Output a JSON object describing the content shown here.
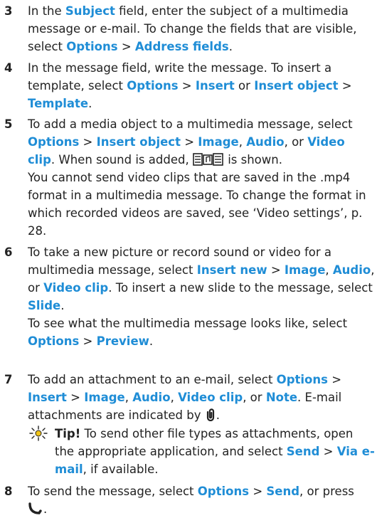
{
  "steps": [
    {
      "number": "3",
      "t1": "In the ",
      "b1": "Subject",
      "t2": " field, enter the subject of a multimedia message or e-mail. To change the fields that are visible, select ",
      "b2": "Options",
      "t3": " > ",
      "b3": "Address fields",
      "t4": "."
    },
    {
      "number": "4",
      "t1": "In the message field, write the message. To insert a template, select ",
      "b1": "Options",
      "t2": " > ",
      "b2": "Insert",
      "t3": " or ",
      "b3": "Insert object",
      "t4": " > ",
      "b4": "Template",
      "t5": "."
    },
    {
      "number": "5",
      "t1": "To add a media object to a multimedia message, select ",
      "b1": "Options",
      "t2": " > ",
      "b2": "Insert object",
      "t3": " > ",
      "b3": "Image",
      "t4": ", ",
      "b4": "Audio",
      "t5": ", or ",
      "b5": "Video clip",
      "t6": ". When sound is added, ",
      "icon1": "sound-added-icon",
      "t7": " is shown.",
      "p2": "You cannot send video clips that are saved in the .mp4 format in a multimedia message. To change the format in which recorded videos are saved, see ‘Video settings’, p. 28."
    },
    {
      "number": "6",
      "t1": "To take a new picture or record sound or video for a multimedia message, select ",
      "b1": "Insert new",
      "t2": " > ",
      "b2": "Image",
      "t3": ", ",
      "b3": "Audio",
      "t4": ", or ",
      "b4": "Video clip",
      "t5": ". To insert a new slide to the message, select ",
      "b5": "Slide",
      "t6": ".",
      "p2_t1": "To see what the multimedia message looks like, select ",
      "p2_b1": "Options",
      "p2_t2": " > ",
      "p2_b2": "Preview",
      "p2_t3": "."
    },
    {
      "number": "7",
      "t1": "To add an attachment to an e-mail, select ",
      "b1": "Options",
      "t2": " > ",
      "b2": "Insert",
      "t3": " > ",
      "b3": "Image",
      "t4": ", ",
      "b4": "Audio",
      "t5": ", ",
      "b5": "Video clip",
      "t6": ", or ",
      "b6": "Note",
      "t7": ". E-mail attachments are indicated by ",
      "icon1": "paperclip-icon",
      "t8": "."
    },
    {
      "number": "8",
      "t1": "To send the message, select ",
      "b1": "Options",
      "t2": " > ",
      "b2": "Send",
      "t3": ", or press ",
      "icon1": "call-key-icon",
      "t4": "."
    }
  ],
  "tip": {
    "icon": "lightbulb-tip-icon",
    "label": "Tip!",
    "t1": " To send other file types as attachments, open the appropriate application, and select ",
    "b1": "Send",
    "t2": " > ",
    "b2": "Via e-mail",
    "t3": ", if available."
  },
  "colors": {
    "highlight": "#1f8dd6",
    "text": "#222222"
  }
}
